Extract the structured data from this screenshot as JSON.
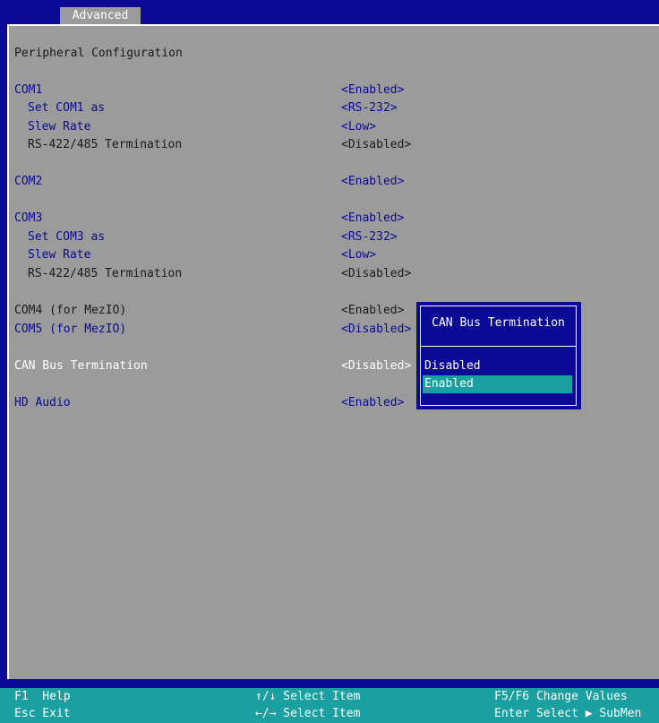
{
  "tabs": {
    "active": "Advanced"
  },
  "section_title": "Peripheral Configuration",
  "settings": {
    "com1": {
      "label": "COM1",
      "value": "<Enabled>"
    },
    "com1_set_as": {
      "label": "Set COM1 as",
      "value": "<RS-232>"
    },
    "com1_slew": {
      "label": "Slew Rate",
      "value": "<Low>"
    },
    "com1_term": {
      "label": "RS-422/485 Termination",
      "value": "<Disabled>"
    },
    "com2": {
      "label": "COM2",
      "value": "<Enabled>"
    },
    "com3": {
      "label": "COM3",
      "value": "<Enabled>"
    },
    "com3_set_as": {
      "label": "Set COM3 as",
      "value": "<RS-232>"
    },
    "com3_slew": {
      "label": "Slew Rate",
      "value": "<Low>"
    },
    "com3_term": {
      "label": "RS-422/485 Termination",
      "value": "<Disabled>"
    },
    "com4": {
      "label": "COM4 (for MezIO)",
      "value": "<Enabled>"
    },
    "com5": {
      "label": "COM5 (for MezIO)",
      "value": "<Disabled>"
    },
    "can_bus": {
      "label": "CAN Bus Termination",
      "value": "<Disabled>"
    },
    "hd_audio": {
      "label": "HD Audio",
      "value": "<Enabled>"
    }
  },
  "popup": {
    "title": "CAN Bus Termination",
    "options": [
      "Disabled",
      "Enabled"
    ],
    "selected": "Enabled"
  },
  "footer": {
    "f1": "F1  Help",
    "esc": "Esc Exit",
    "select_item_ud": "↑/↓ Select Item",
    "select_item_lr": "←/→ Select Item",
    "f5f6": "F5/F6 Change Values",
    "enter": "Enter Select ▶ SubMen"
  },
  "colors": {
    "bios_blue": "#0a0a96",
    "panel_gray": "#9b9b9b",
    "highlight_teal": "#1aa0a0"
  }
}
